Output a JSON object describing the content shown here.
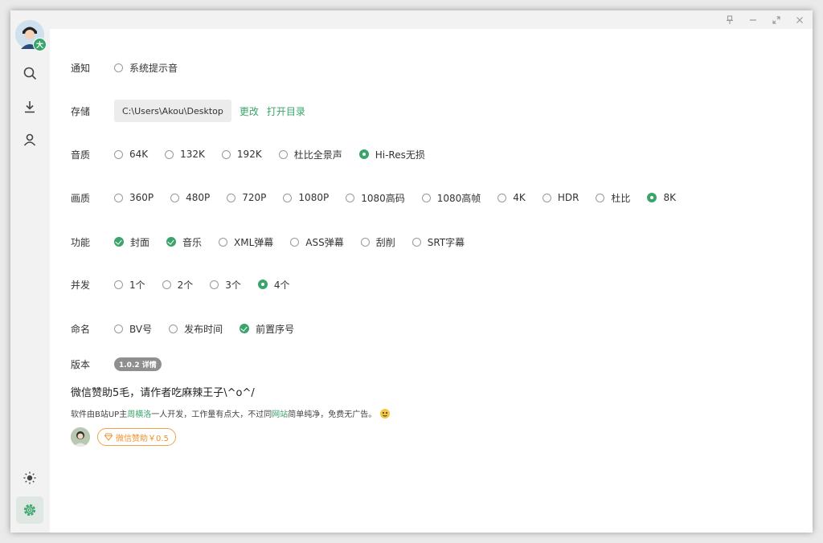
{
  "colors": {
    "accent": "#3aa46a",
    "orange": "#f0902a",
    "sidebar_bg": "#f2f2f2"
  },
  "sidebar": {
    "avatar_badge": "大",
    "icons": [
      "search-icon",
      "download-icon",
      "user-icon",
      "brightness-icon",
      "settings-icon"
    ]
  },
  "titlebar": {
    "buttons": [
      "pin-icon",
      "minimize-icon",
      "maximize-icon",
      "close-icon"
    ]
  },
  "settings": {
    "notify": {
      "label": "通知",
      "options": [
        {
          "label": "系统提示音",
          "state": "radio-off"
        }
      ]
    },
    "storage": {
      "label": "存储",
      "path": "C:\\Users\\Akou\\Desktop",
      "change": "更改",
      "open": "打开目录"
    },
    "audio": {
      "label": "音质",
      "options": [
        {
          "label": "64K",
          "state": "radio-off"
        },
        {
          "label": "132K",
          "state": "radio-off"
        },
        {
          "label": "192K",
          "state": "radio-off"
        },
        {
          "label": "杜比全景声",
          "state": "radio-off"
        },
        {
          "label": "Hi-Res无损",
          "state": "radio-on"
        }
      ]
    },
    "video": {
      "label": "画质",
      "options": [
        {
          "label": "360P",
          "state": "radio-off"
        },
        {
          "label": "480P",
          "state": "radio-off"
        },
        {
          "label": "720P",
          "state": "radio-off"
        },
        {
          "label": "1080P",
          "state": "radio-off"
        },
        {
          "label": "1080高码",
          "state": "radio-off"
        },
        {
          "label": "1080高帧",
          "state": "radio-off"
        },
        {
          "label": "4K",
          "state": "radio-off"
        },
        {
          "label": "HDR",
          "state": "radio-off"
        },
        {
          "label": "杜比",
          "state": "radio-off"
        },
        {
          "label": "8K",
          "state": "radio-on"
        }
      ]
    },
    "features": {
      "label": "功能",
      "options": [
        {
          "label": "封面",
          "state": "check"
        },
        {
          "label": "音乐",
          "state": "check"
        },
        {
          "label": "XML弹幕",
          "state": "radio-off"
        },
        {
          "label": "ASS弹幕",
          "state": "radio-off"
        },
        {
          "label": "刮削",
          "state": "radio-off"
        },
        {
          "label": "SRT字幕",
          "state": "radio-off"
        }
      ]
    },
    "concurrency": {
      "label": "并发",
      "options": [
        {
          "label": "1个",
          "state": "radio-off"
        },
        {
          "label": "2个",
          "state": "radio-off"
        },
        {
          "label": "3个",
          "state": "radio-off"
        },
        {
          "label": "4个",
          "state": "radio-on"
        }
      ]
    },
    "naming": {
      "label": "命名",
      "options": [
        {
          "label": "BV号",
          "state": "radio-off"
        },
        {
          "label": "发布时间",
          "state": "radio-off"
        },
        {
          "label": "前置序号",
          "state": "check"
        }
      ]
    },
    "version": {
      "label": "版本",
      "badge": "1.0.2 详情"
    }
  },
  "donate": {
    "title": "微信赞助5毛，请作者吃麻辣王子\\^o^/",
    "desc_prefix": "软件由B站UP主 ",
    "desc_author": "周横洛",
    "desc_mid": " 一人开发，工作量有点大，不过同 ",
    "desc_site": "网站",
    "desc_suffix": " 简单纯净，免费无广告。",
    "button": "微信赞助￥0.5"
  }
}
